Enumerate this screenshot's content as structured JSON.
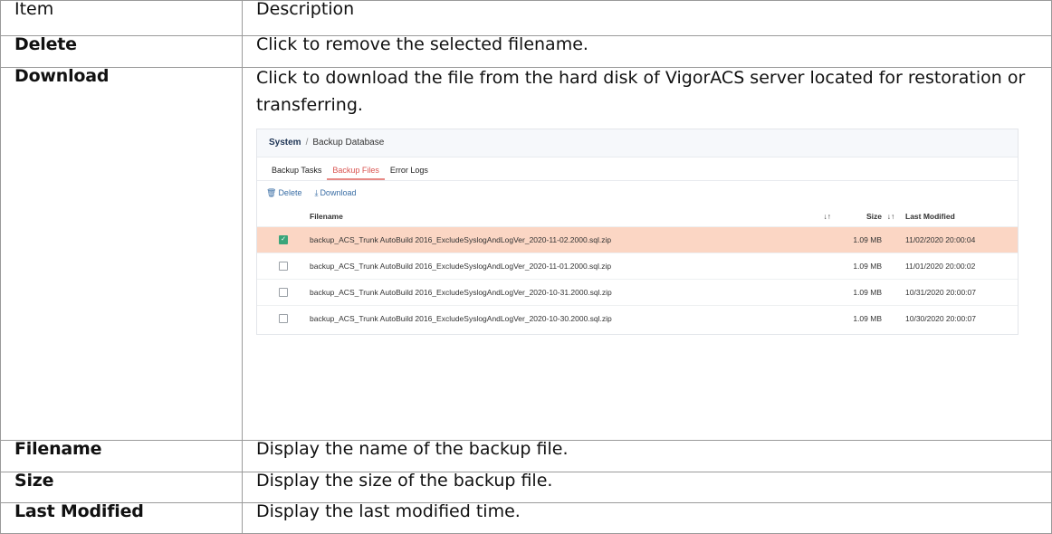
{
  "header": {
    "item": "Item",
    "description": "Description"
  },
  "rows": {
    "delete": {
      "item": "Delete",
      "description": "Click to remove the selected filename."
    },
    "download": {
      "item": "Download",
      "description": "Click to download the file from the hard disk of VigorACS server located for restoration or transferring."
    },
    "filename": {
      "item": "Filename",
      "description": "Display the name of the backup file."
    },
    "size": {
      "item": "Size",
      "description": "Display the size of the backup file."
    },
    "last_modified": {
      "item": "Last Modified",
      "description": "Display the last modified time."
    }
  },
  "screenshot": {
    "breadcrumb_root": "System",
    "breadcrumb_sep": "/",
    "breadcrumb_page": "Backup Database",
    "tabs": [
      "Backup Tasks",
      "Backup Files",
      "Error Logs"
    ],
    "active_tab": "Backup Files",
    "toolbar": {
      "delete": "Delete",
      "download": "Download"
    },
    "columns": {
      "filename": "Filename",
      "size": "Size",
      "last_modified": "Last Modified"
    },
    "files": [
      {
        "name": "backup_ACS_Trunk AutoBuild 2016_ExcludeSyslogAndLogVer_2020-11-02.2000.sql.zip",
        "size": "1.09 MB",
        "modified": "11/02/2020 20:00:04",
        "checked": true
      },
      {
        "name": "backup_ACS_Trunk AutoBuild 2016_ExcludeSyslogAndLogVer_2020-11-01.2000.sql.zip",
        "size": "1.09 MB",
        "modified": "11/01/2020 20:00:02",
        "checked": false
      },
      {
        "name": "backup_ACS_Trunk AutoBuild 2016_ExcludeSyslogAndLogVer_2020-10-31.2000.sql.zip",
        "size": "1.09 MB",
        "modified": "10/31/2020 20:00:07",
        "checked": false
      },
      {
        "name": "backup_ACS_Trunk AutoBuild 2016_ExcludeSyslogAndLogVer_2020-10-30.2000.sql.zip",
        "size": "1.09 MB",
        "modified": "10/30/2020 20:00:07",
        "checked": false
      }
    ]
  }
}
